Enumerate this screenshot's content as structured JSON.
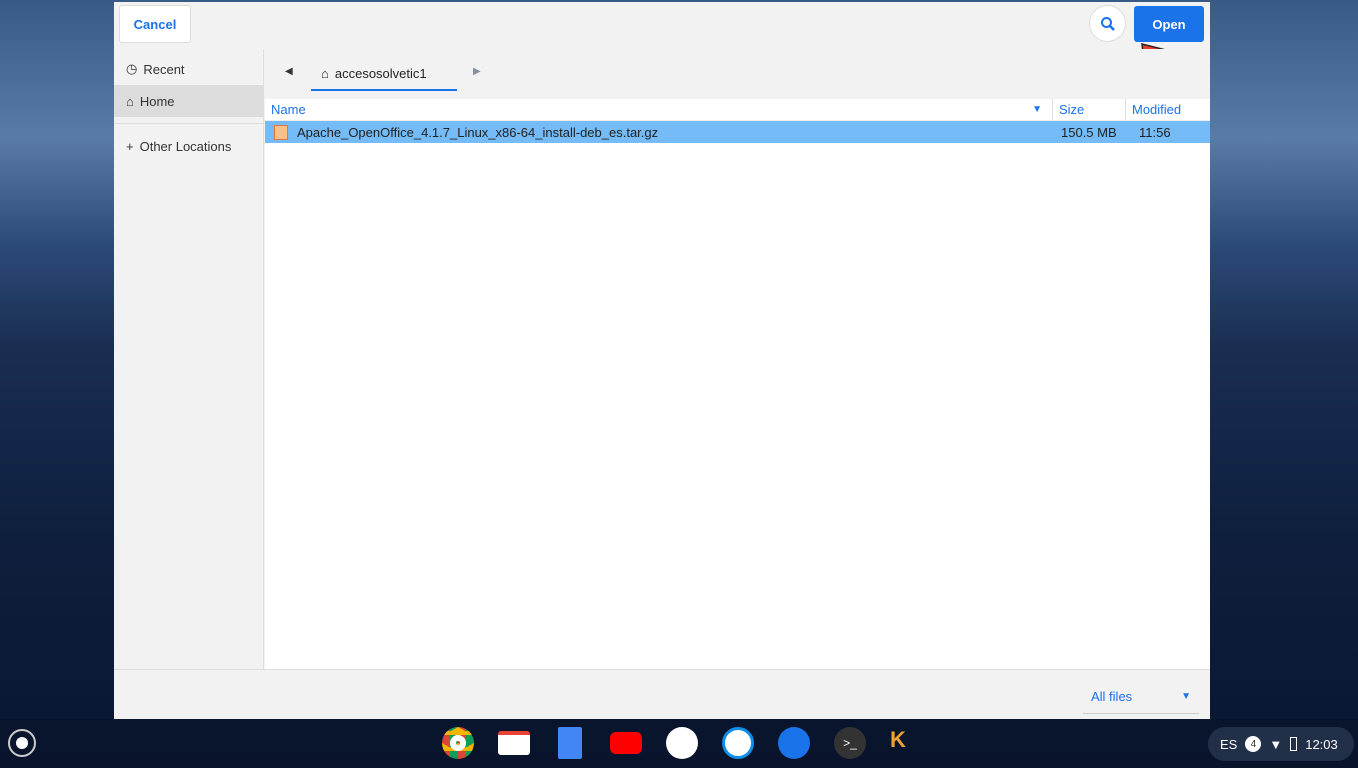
{
  "header": {
    "cancel": "Cancel",
    "open": "Open",
    "search_icon": "search-icon"
  },
  "sidebar": {
    "items": [
      {
        "label": "Recent",
        "icon": "clock-icon"
      },
      {
        "label": "Home",
        "icon": "home-icon"
      },
      {
        "label": "Other Locations",
        "icon": "plus-icon"
      }
    ]
  },
  "path": {
    "current": "accesosolvetic1"
  },
  "columns": {
    "name": "Name",
    "size": "Size",
    "modified": "Modified"
  },
  "files": [
    {
      "name": "Apache_OpenOffice_4.1.7_Linux_x86-64_install-deb_es.tar.gz",
      "size": "150.5 MB",
      "modified": "11:56"
    }
  ],
  "footer": {
    "filter": "All files"
  },
  "shelf": {
    "lang": "ES",
    "notifications": "4",
    "time": "12:03"
  },
  "colors": {
    "accent": "#1a73e8",
    "selection": "#74bbf7"
  }
}
